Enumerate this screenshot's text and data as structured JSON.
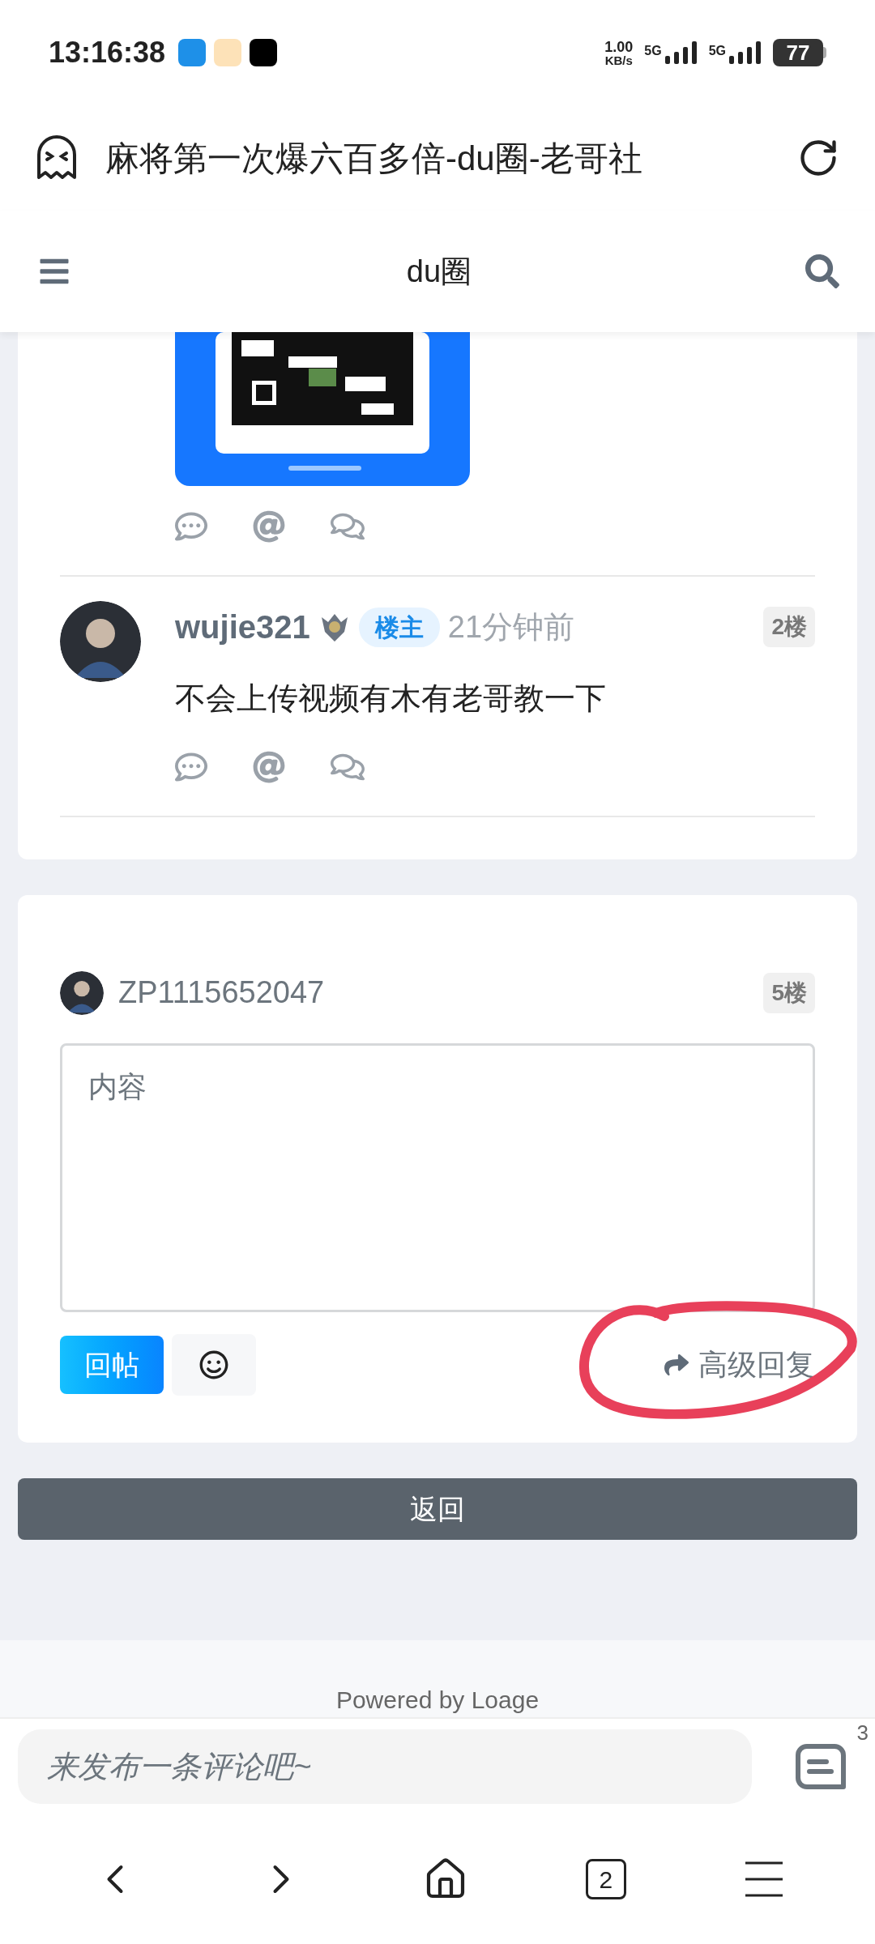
{
  "status_bar": {
    "time": "13:16:38",
    "speed": "1.00",
    "speed_unit": "KB/s",
    "network_1": "5G",
    "network_2": "5G",
    "battery": "77"
  },
  "address_bar": {
    "title": "麻将第一次爆六百多倍-du圈-老哥社"
  },
  "header": {
    "title": "du圈"
  },
  "posts": [
    {
      "user": "wujie321",
      "badge": "楼主",
      "time": "21分钟前",
      "floor": "2楼",
      "content": "不会上传视频有木有老哥教一下"
    }
  ],
  "reply": {
    "user": "ZP1115652047",
    "floor": "5楼",
    "placeholder": "内容",
    "submit": "回帖",
    "advanced": "高级回复"
  },
  "back_button": "返回",
  "footer": "Powered by Loage",
  "comment_bar": {
    "placeholder": "来发布一条评论吧~",
    "count": "3"
  },
  "nav": {
    "tabs_count": "2"
  }
}
